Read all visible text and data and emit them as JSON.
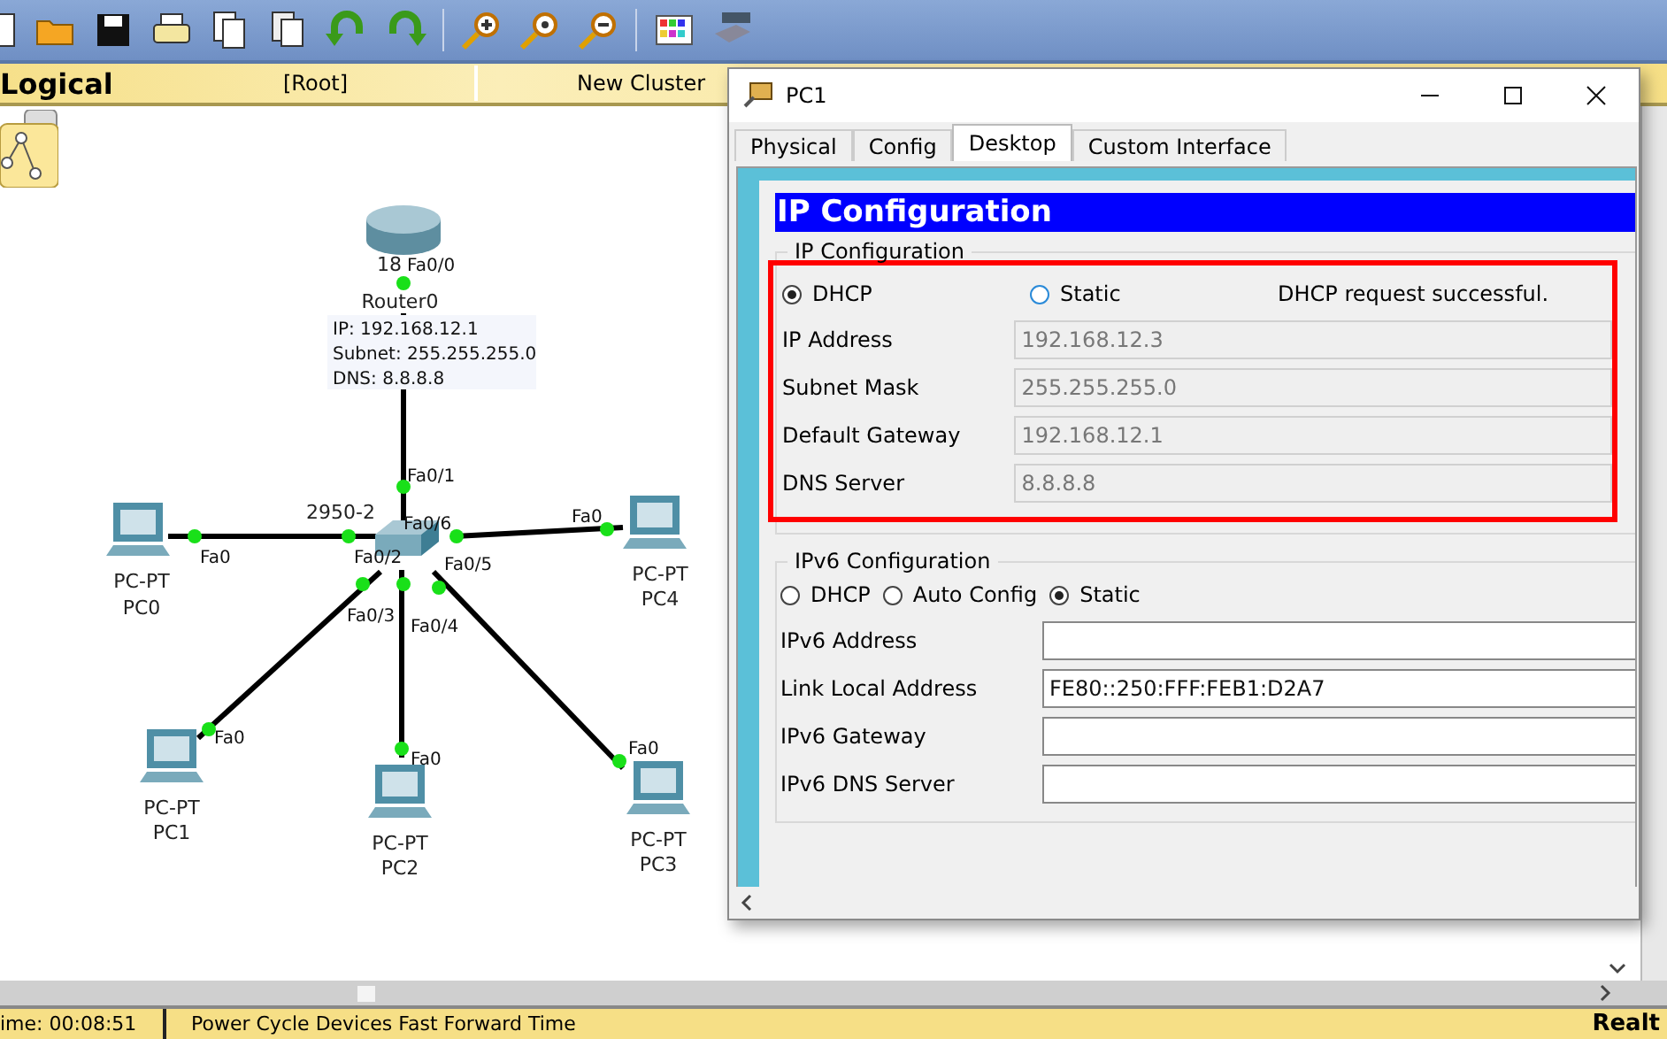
{
  "workspace_bar": {
    "mode": "Logical",
    "path": "[Root]",
    "cluster": "New Cluster"
  },
  "topology": {
    "devices": [
      {
        "kind": "router",
        "model": "18",
        "name": "Router0"
      },
      {
        "kind": "switch",
        "model": "2950-2"
      },
      {
        "kind": "pc",
        "model": "PC-PT",
        "name": "PC0"
      },
      {
        "kind": "pc",
        "model": "PC-PT",
        "name": "PC4"
      },
      {
        "kind": "pc",
        "model": "PC-PT",
        "name": "PC1"
      },
      {
        "kind": "pc",
        "model": "PC-PT",
        "name": "PC2"
      },
      {
        "kind": "pc",
        "model": "PC-PT",
        "name": "PC3"
      }
    ],
    "router_info": [
      "IP: 192.168.12.1",
      "Subnet: 255.255.255.0",
      "DNS: 8.8.8.8"
    ],
    "links": [
      {
        "ports": [
          "Fa0/0",
          "Fa0/1"
        ]
      },
      {
        "ports": [
          "Fa0",
          "Fa0/2"
        ]
      },
      {
        "ports": [
          "Fa0/6",
          "Fa0"
        ]
      },
      {
        "ports": [
          "Fa0/3",
          "Fa0"
        ]
      },
      {
        "ports": [
          "Fa0/4",
          "Fa0"
        ]
      },
      {
        "ports": [
          "Fa0/5",
          "Fa0"
        ]
      }
    ]
  },
  "dialog": {
    "title": "PC1",
    "tabs": [
      {
        "label": "Physical",
        "selected": false
      },
      {
        "label": "Config",
        "selected": false
      },
      {
        "label": "Desktop",
        "selected": true
      },
      {
        "label": "Custom Interface",
        "selected": false
      }
    ],
    "app_title": "IP Configuration",
    "ipv4": {
      "legend": "IP Configuration",
      "highlighted": true,
      "modes": [
        {
          "label": "DHCP",
          "selected": true
        },
        {
          "label": "Static",
          "selected": false
        }
      ],
      "status": "DHCP request successful.",
      "fields": [
        {
          "label": "IP Address",
          "value": "192.168.12.3",
          "disabled": true
        },
        {
          "label": "Subnet Mask",
          "value": "255.255.255.0",
          "disabled": true
        },
        {
          "label": "Default Gateway",
          "value": "192.168.12.1",
          "disabled": true
        },
        {
          "label": "DNS Server",
          "value": "8.8.8.8",
          "disabled": true
        }
      ]
    },
    "ipv6": {
      "legend": "IPv6 Configuration",
      "modes": [
        {
          "label": "DHCP",
          "selected": false
        },
        {
          "label": "Auto Config",
          "selected": false
        },
        {
          "label": "Static",
          "selected": true
        }
      ],
      "fields": [
        {
          "label": "IPv6 Address",
          "disabled": false
        },
        {
          "label": "Link Local Address",
          "value": "FE80::250:FFF:FEB1:D2A7",
          "disabled": false
        },
        {
          "label": "IPv6 Gateway",
          "disabled": false
        },
        {
          "label": "IPv6 DNS Server",
          "disabled": false
        }
      ]
    }
  },
  "status_bar": {
    "time": "ime: 00:08:51",
    "actions": "Power Cycle Devices  Fast Forward Time",
    "mode": "Realt"
  }
}
